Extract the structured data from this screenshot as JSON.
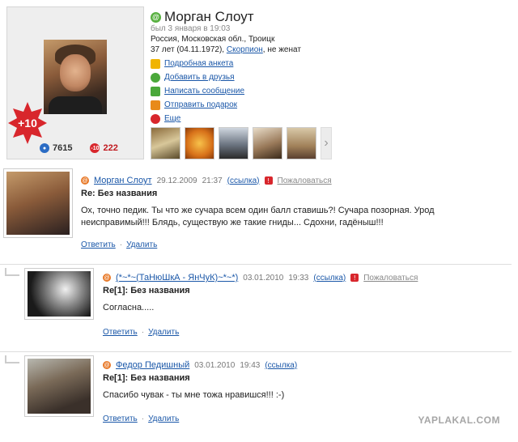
{
  "profile": {
    "name": "Морган Слоут",
    "last_seen": "был 3 января в 19:03",
    "location": "Россия, Московская обл., Троицк",
    "age_prefix": "37 лет (04.11.1972),",
    "zodiac": "Скорпион",
    "marital": ", не женат",
    "rating_badge": "+10",
    "stat_blue": "7615",
    "stat_red": "222",
    "stat_red_icon_text": "-10",
    "actions": [
      {
        "label": "Подробная анкета",
        "icon": "info-icon",
        "color": "#f0b400"
      },
      {
        "label": "Добавить в друзья",
        "icon": "add-friend-icon",
        "color": "#4aa83a"
      },
      {
        "label": "Написать сообщение",
        "icon": "message-icon",
        "color": "#4aa83a"
      },
      {
        "label": "Отправить подарок",
        "icon": "gift-icon",
        "color": "#e88a1a"
      },
      {
        "label": "Еще",
        "icon": "more-icon",
        "color": "#d8262c"
      }
    ],
    "photos_next": "›"
  },
  "comments": [
    {
      "author": "Морган Слоут",
      "date": "29.12.2009",
      "time": "21:37",
      "ref_link": "(ссылка)",
      "complain": "Пожаловаться",
      "title": "Re: Без названия",
      "text": "Ох, точно педик. Ты что же сучара всем один балл ставишь?! Сучара позорная. Урод неисправимый!!! Блядь, существую же такие гниды... Сдохни, гадёныш!!!",
      "reply": "Ответить",
      "delete": "Удалить"
    },
    {
      "author": "(*~*~(ТаНюШкА - ЯнЧуК)~*~*)",
      "date": "03.01.2010",
      "time": "19:33",
      "ref_link": "(ссылка)",
      "complain": "Пожаловаться",
      "title": "Re[1]: Без названия",
      "text": "Согласна.....",
      "reply": "Ответить",
      "delete": "Удалить"
    },
    {
      "author": "Федор Педишный",
      "date": "03.01.2010",
      "time": "19:43",
      "ref_link": "(ссылка)",
      "title": "Re[1]: Без названия",
      "text": "Спасибо чувак - ты мне тожа нравишся!!! :-)",
      "reply": "Ответить",
      "delete": "Удалить"
    }
  ],
  "link_separator": "·",
  "watermark": "YAPLAKAL.COM"
}
